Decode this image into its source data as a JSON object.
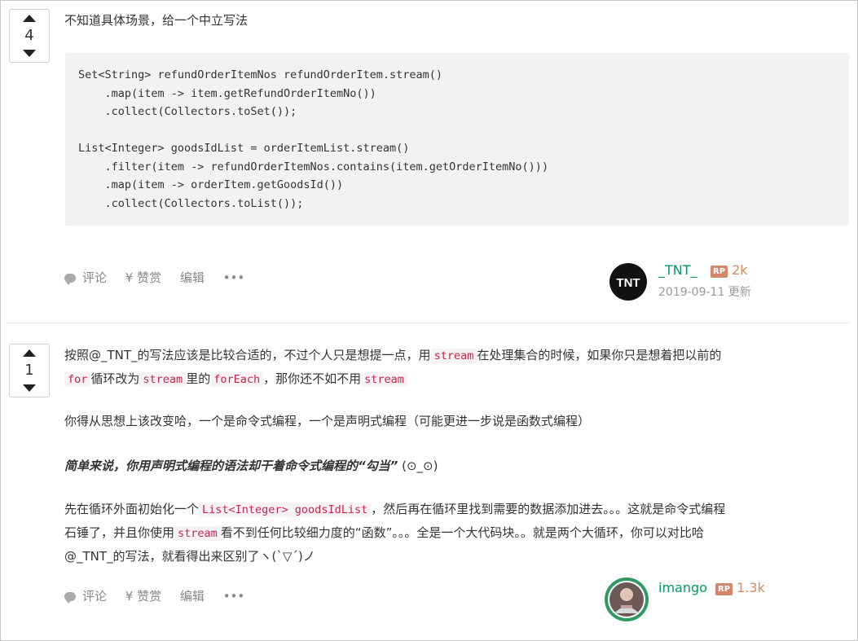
{
  "answers": [
    {
      "votes": "4",
      "intro": "不知道具体场景，给一个中立写法",
      "code": "Set<String> refundOrderItemNos refundOrderItem.stream()\n    .map(item -> item.getRefundOrderItemNo())\n    .collect(Collectors.toSet());\n\nList<Integer> goodsIdList = orderItemList.stream()\n    .filter(item -> refundOrderItemNos.contains(item.getOrderItemNo()))\n    .map(item -> orderItem.getGoodsId())\n    .collect(Collectors.toList());",
      "actions": {
        "comment": "评论",
        "reward": "¥ 赞赏",
        "edit": "编辑",
        "more": "•••"
      },
      "author": {
        "name": "_TNT_",
        "rp_badge": "RP",
        "reputation": "2k",
        "date": "2019-09-11 更新",
        "avatar_text": "TNT"
      }
    },
    {
      "votes": "1",
      "p1": {
        "t1": "按照@_TNT_的写法应该是比较合适的，不过个人只是想提一点，用",
        "c1": "stream",
        "t2": "在处理集合的时候，如果你只是想着把以前的",
        "c2": "for",
        "t3": "循环改为",
        "c3": "stream",
        "t4": "里的",
        "c4": "forEach",
        "t5": "，那你还不如不用",
        "c5": "stream"
      },
      "p2": "你得从思想上该改变哈，一个是命令式编程，一个是声明式编程（可能更进一步说是函数式编程）",
      "p3": {
        "bold": "简单来说，你用声明式编程的语法却干着命令式编程的“勾当”",
        "emoticon": "(⊙_⊙)"
      },
      "p4": {
        "t1": "先在循环外面初始化一个",
        "c1": "List<Integer> goodsIdList",
        "t2": "，然后再在循环里找到需要的数据添加进去。。。这就是命令式编程",
        "t3": "石锤了，并且你使用",
        "c2": "stream",
        "t4": "看不到任何比较细力度的“函数”。。。全是一个大代码块。。就是两个大循环，你可以对比哈",
        "t5": "@_TNT_的写法，就看得出来区别了ヽ(ˋ▽ˊ)ノ"
      },
      "actions": {
        "comment": "评论",
        "reward": "¥ 赞赏",
        "edit": "编辑",
        "more": "•••"
      },
      "author": {
        "name": "imango",
        "rp_badge": "RP",
        "reputation": "1.3k"
      }
    }
  ]
}
